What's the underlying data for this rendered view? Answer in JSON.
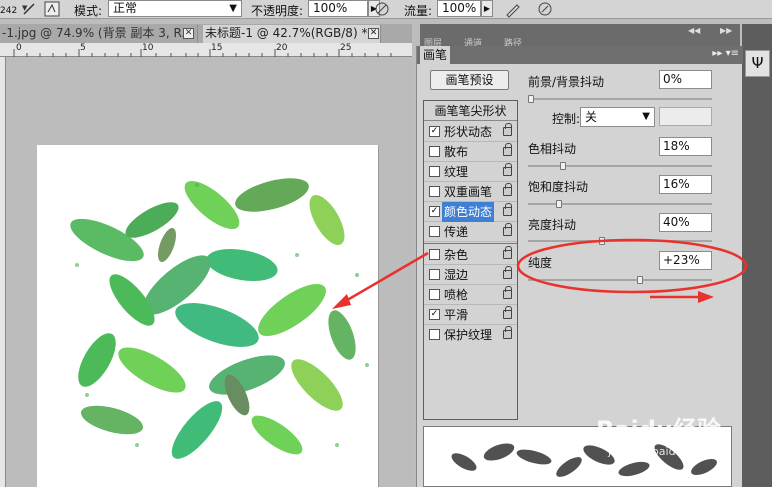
{
  "options_bar": {
    "brush_size": "242",
    "mode_label": "模式:",
    "mode_value": "正常",
    "opacity_label": "不透明度:",
    "opacity_value": "100%",
    "flow_label": "流量:",
    "flow_value": "100%"
  },
  "tabs": [
    {
      "label": "-1.jpg @ 74.9% (背景 副本 3, R..."
    },
    {
      "label": "未标题-1 @ 42.7%(RGB/8) *"
    }
  ],
  "ruler": {
    "h_marks": [
      "0",
      "5",
      "10",
      "15",
      "20",
      "25"
    ]
  },
  "dock": {
    "tabs": [
      "图层",
      "通道",
      "路径"
    ]
  },
  "brush_panel": {
    "title": "画笔",
    "preset_button": "画笔预设",
    "list_header": "画笔笔尖形状",
    "items": [
      {
        "label": "形状动态",
        "checked": true,
        "selected": false
      },
      {
        "label": "散布",
        "checked": false,
        "selected": false
      },
      {
        "label": "纹理",
        "checked": false,
        "selected": false
      },
      {
        "label": "双重画笔",
        "checked": false,
        "selected": false
      },
      {
        "label": "颜色动态",
        "checked": true,
        "selected": true
      },
      {
        "label": "传递",
        "checked": false,
        "selected": false
      },
      {
        "label": "杂色",
        "checked": false,
        "selected": false
      },
      {
        "label": "湿边",
        "checked": false,
        "selected": false
      },
      {
        "label": "喷枪",
        "checked": false,
        "selected": false
      },
      {
        "label": "平滑",
        "checked": true,
        "selected": false
      },
      {
        "label": "保护纹理",
        "checked": false,
        "selected": false
      }
    ],
    "fg_bg_jitter": {
      "label": "前景/背景抖动",
      "value": "0%",
      "slider": 0.0
    },
    "control": {
      "label": "控制:",
      "value": "关"
    },
    "hue_jitter": {
      "label": "色相抖动",
      "value": "18%",
      "slider": 0.18
    },
    "saturation_jitter": {
      "label": "饱和度抖动",
      "value": "16%",
      "slider": 0.16
    },
    "brightness_jitter": {
      "label": "亮度抖动",
      "value": "40%",
      "slider": 0.4
    },
    "purity": {
      "label": "纯度",
      "value": "+23%",
      "slider": 0.615
    }
  },
  "watermark": {
    "text": "Baidu经验",
    "sub": "jingyan.baidu.com"
  },
  "colors": {
    "annotation_red": "#e8322e",
    "selection_blue": "#3f7fd4",
    "leaf_greens": [
      "#2fae3e",
      "#56c93a",
      "#21b061",
      "#7bc93b",
      "#49a84a"
    ]
  }
}
